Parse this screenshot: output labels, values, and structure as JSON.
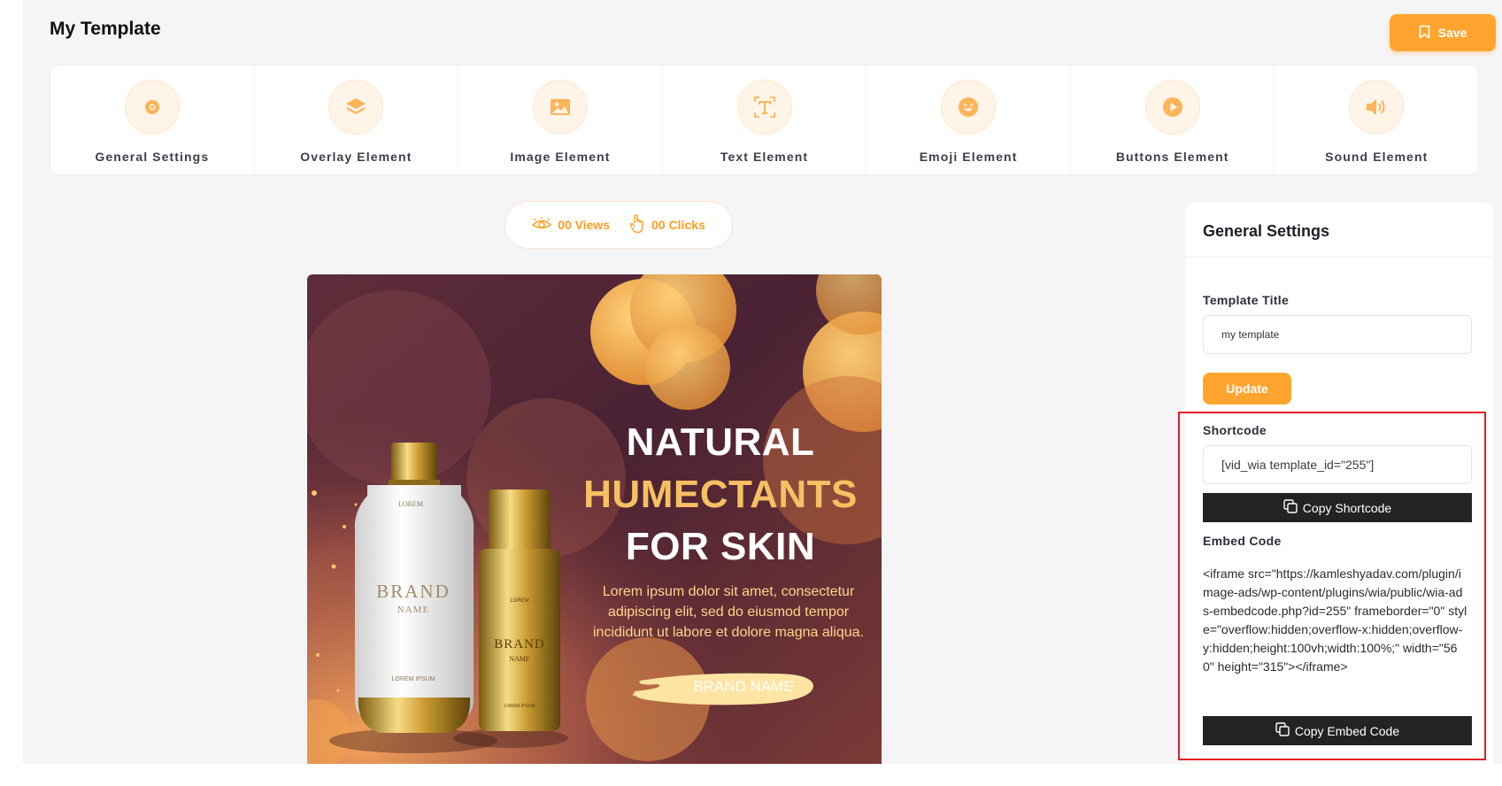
{
  "header": {
    "title": "My Template",
    "save_label": "Save"
  },
  "toolbar": {
    "items": [
      {
        "label": "General Settings",
        "icon": "gear-icon"
      },
      {
        "label": "Overlay Element",
        "icon": "layers-icon"
      },
      {
        "label": "Image Element",
        "icon": "image-icon"
      },
      {
        "label": "Text Element",
        "icon": "text-icon"
      },
      {
        "label": "Emoji Element",
        "icon": "emoji-icon"
      },
      {
        "label": "Buttons Element",
        "icon": "play-button-icon"
      },
      {
        "label": "Sound Element",
        "icon": "speaker-icon"
      }
    ]
  },
  "stats": {
    "views": "00 Views",
    "clicks": "00 Clicks"
  },
  "ad": {
    "headline_1": "NATURAL",
    "headline_2": "HUMECTANTS",
    "headline_3": "FOR SKIN",
    "body": "Lorem ipsum dolor sit amet, consectetur adipiscing elit, sed do eiusmod tempor incididunt ut labore et dolore magna aliqua.",
    "button": "BRAND NAME",
    "bottle1_brand": "BRAND",
    "bottle1_name": "NAME",
    "bottle1_top": "LOREM",
    "bottle1_bottom": "LOREM IPSUM",
    "bottle2_brand": "BRAND",
    "bottle2_name": "NAME",
    "bottle2_top": "LOREM",
    "bottle2_bottom": "LOREM IPSUM"
  },
  "panel": {
    "title": "General Settings",
    "template_title_label": "Template Title",
    "template_title_value": "my template",
    "update_label": "Update",
    "shortcode_label": "Shortcode",
    "shortcode_value": "[vid_wia template_id=\"255\"]",
    "copy_shortcode_label": "Copy Shortcode",
    "embed_label": "Embed Code",
    "embed_value": "<iframe src=\"https://kamleshyadav.com/plugin/image-ads/wp-content/plugins/wia/public/wia-ads-embedcode.php?id=255\" frameborder=\"0\" style=\"overflow:hidden;overflow-x:hidden;overflow-y:hidden;height:100vh;width:100%;\" width=\"560\" height=\"315\"></iframe>",
    "copy_embed_label": "Copy Embed Code"
  },
  "colors": {
    "accent": "#ffa52f",
    "highlight_border": "#e31e24",
    "dark_button": "#232323"
  }
}
